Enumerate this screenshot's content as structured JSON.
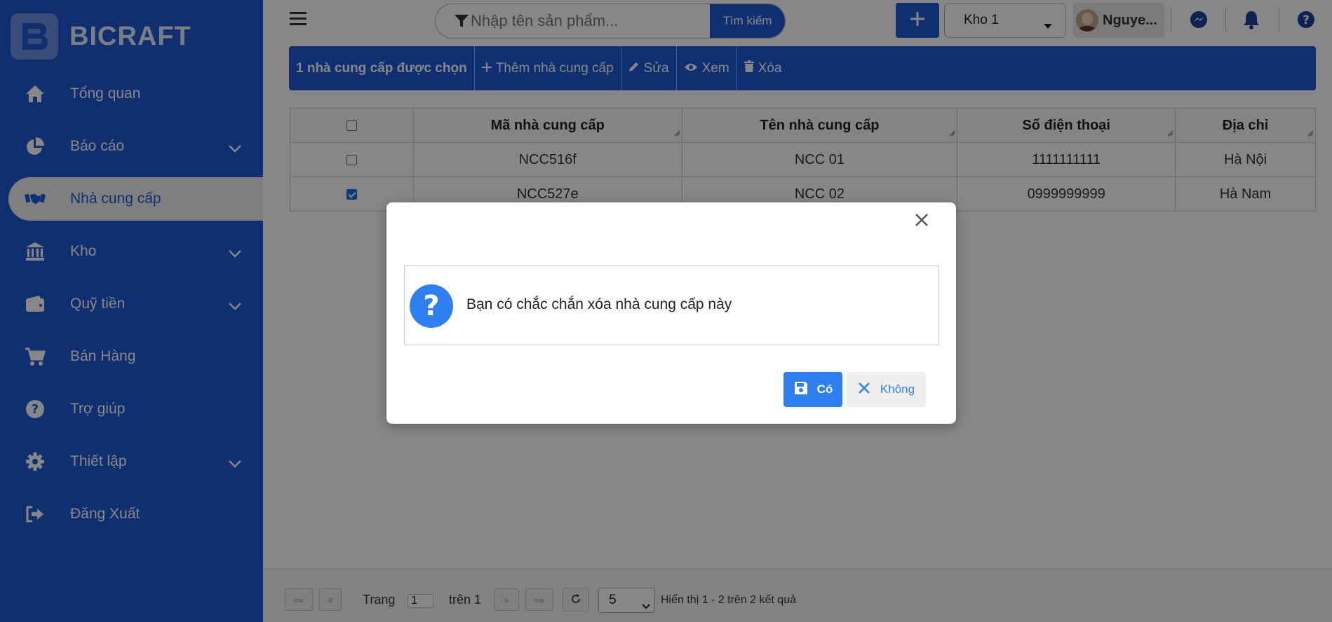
{
  "brand": {
    "name": "BICRAFT"
  },
  "sidebar": {
    "items": [
      {
        "label": "Tổng quan",
        "icon": "home-icon"
      },
      {
        "label": "Báo cáo",
        "icon": "pie-chart-icon"
      },
      {
        "label": "Nhà cung cấp",
        "icon": "handshake-icon"
      },
      {
        "label": "Kho",
        "icon": "bank-icon"
      },
      {
        "label": "Quỹ tiền",
        "icon": "wallet-icon"
      },
      {
        "label": "Bán Hàng",
        "icon": "cart-icon"
      },
      {
        "label": "Trợ giúp",
        "icon": "help-icon"
      },
      {
        "label": "Thiết lập",
        "icon": "gear-icon"
      },
      {
        "label": "Đăng Xuất",
        "icon": "logout-icon"
      }
    ]
  },
  "search": {
    "placeholder": "Nhập tên sản phẩm...",
    "button_label": "Tìm kiếm"
  },
  "store": {
    "selected": "Kho 1"
  },
  "user": {
    "name": "Nguye..."
  },
  "toolbar": {
    "selected_label": "1 nhà cung cấp được chọn",
    "add_label": "Thêm nhà cung cấp",
    "edit_label": "Sửa",
    "view_label": "Xem",
    "delete_label": "Xóa"
  },
  "table": {
    "columns": [
      "Mã nhà cung cấp",
      "Tên nhà cung cấp",
      "Số điện thoại",
      "Địa chỉ"
    ],
    "rows": [
      {
        "code": "NCC516f",
        "name": "NCC 01",
        "phone": "1111111111",
        "address": "Hà Nội",
        "checked": false
      },
      {
        "code": "NCC527e",
        "name": "NCC 02",
        "phone": "0999999999",
        "address": "Hà Nam",
        "checked": true
      }
    ]
  },
  "pagination": {
    "first": "««",
    "prev": "«",
    "next": "»",
    "last": "»»",
    "page_label": "Trang",
    "page_value": "1",
    "of_label": "trên 1",
    "page_size": "5",
    "summary": "Hiển thị 1 - 2 trên 2 kết quả"
  },
  "dialog": {
    "message": "Bạn có chắc chắn xóa nhà cung cấp này",
    "yes_label": "Có",
    "no_label": "Không"
  },
  "colors": {
    "primary": "#1f5ad3",
    "dialog_accent": "#2f7ff0"
  }
}
